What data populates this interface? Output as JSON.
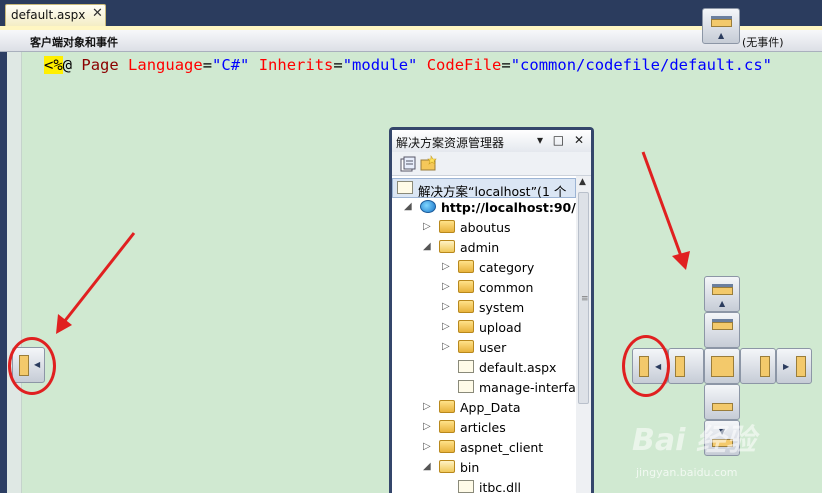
{
  "tab": {
    "title": "default.aspx",
    "close_glyph": "✕"
  },
  "navbar": {
    "left_label": "客户端对象和事件",
    "right_label": "(无事件)"
  },
  "code": {
    "open": "<%",
    "at": "@",
    "directive": "Page",
    "a1": "Language",
    "v1": "\"C#\"",
    "a2": "Inherits",
    "v2": "\"module\"",
    "a3": "CodeFile",
    "v3": "\"common/codefile/default.cs\""
  },
  "solution_explorer": {
    "title": "解决方案资源管理器",
    "title_buttons": "▾ □ ✕",
    "rows": [
      {
        "label": "解决方案“localhost”(1 个",
        "icon": "solution-icon",
        "expander": ""
      },
      {
        "label": "http://localhost:90/",
        "icon": "website-globe-icon",
        "expander": "◢"
      },
      {
        "label": "aboutus",
        "icon": "folder-icon",
        "expander": "▷"
      },
      {
        "label": "admin",
        "icon": "folder-open-icon",
        "expander": "◢"
      },
      {
        "label": "category",
        "icon": "folder-icon",
        "expander": "▷"
      },
      {
        "label": "common",
        "icon": "folder-icon",
        "expander": "▷"
      },
      {
        "label": "system",
        "icon": "folder-icon",
        "expander": "▷"
      },
      {
        "label": "upload",
        "icon": "folder-icon",
        "expander": "▷"
      },
      {
        "label": "user",
        "icon": "folder-icon",
        "expander": "▷"
      },
      {
        "label": "default.aspx",
        "icon": "aspx-file-icon",
        "expander": ""
      },
      {
        "label": "manage-interfa",
        "icon": "aspx-file-icon",
        "expander": ""
      },
      {
        "label": "App_Data",
        "icon": "folder-icon",
        "expander": "▷"
      },
      {
        "label": "articles",
        "icon": "folder-icon",
        "expander": "▷"
      },
      {
        "label": "aspnet_client",
        "icon": "folder-icon",
        "expander": "▷"
      },
      {
        "label": "bin",
        "icon": "folder-open-icon",
        "expander": "◢"
      },
      {
        "label": "itbc.dll",
        "icon": "dll-file-icon",
        "expander": ""
      }
    ]
  },
  "watermark": {
    "brand": "Bai  经验",
    "url": "jingyan.baidu.com"
  },
  "colors": {
    "editor_bg": "#d0e9d1",
    "chrome": "#2b3c5e",
    "highlight": "#ffef00",
    "annotation_red": "#e02020"
  }
}
